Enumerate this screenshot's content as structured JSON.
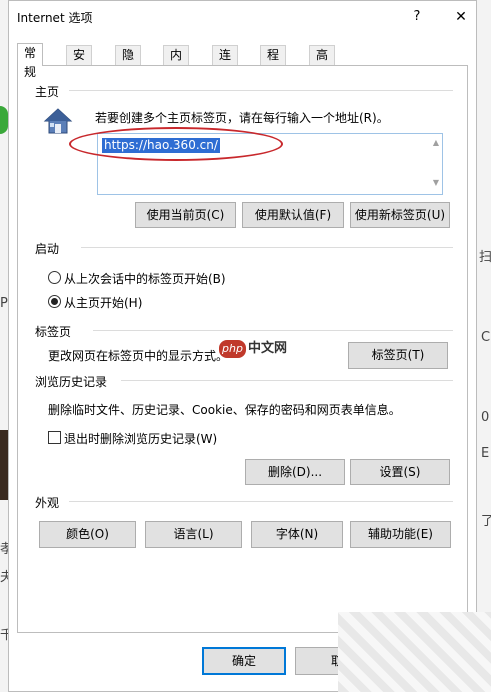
{
  "window": {
    "title": "Internet 选项",
    "help_glyph": "?",
    "close_glyph": "✕"
  },
  "tabs": [
    {
      "label": "常规",
      "active": true
    },
    {
      "label": "安全"
    },
    {
      "label": "隐私"
    },
    {
      "label": "内容"
    },
    {
      "label": "连接"
    },
    {
      "label": "程序"
    },
    {
      "label": "高级"
    }
  ],
  "home": {
    "title": "主页",
    "description": "若要创建多个主页标签页，请在每行输入一个地址(R)。",
    "url": "https://hao.360.cn/",
    "buttons": {
      "use_current": "使用当前页(C)",
      "use_default": "使用默认值(F)",
      "use_new_tab": "使用新标签页(U)"
    },
    "icon": "house-icon"
  },
  "startup": {
    "title": "启动",
    "options": [
      {
        "label": "从上次会话中的标签页开始(B)",
        "checked": false
      },
      {
        "label": "从主页开始(H)",
        "checked": true
      }
    ]
  },
  "tabs_section": {
    "title": "标签页",
    "description": "更改网页在标签页中的显示方式。",
    "button": "标签页(T)"
  },
  "history": {
    "title": "浏览历史记录",
    "description": "删除临时文件、历史记录、Cookie、保存的密码和网页表单信息。",
    "checkbox_label": "退出时删除浏览历史记录(W)",
    "checkbox_checked": false,
    "buttons": {
      "delete": "删除(D)...",
      "settings": "设置(S)"
    }
  },
  "appearance": {
    "title": "外观",
    "buttons": {
      "colors": "颜色(O)",
      "languages": "语言(L)",
      "fonts": "字体(N)",
      "accessibility": "辅助功能(E)"
    }
  },
  "footer": {
    "ok": "确定",
    "cancel": "取"
  },
  "watermark": {
    "logo": "php",
    "text": "中文网"
  },
  "background": {
    "glyphs": [
      "扫",
      "P",
      "0",
      "C",
      "E",
      "了",
      "孝",
      "夫",
      "千"
    ]
  },
  "colors": {
    "accent": "#0078d7",
    "highlight_ellipse": "#c8282c",
    "selection": "#2e6dd3"
  }
}
